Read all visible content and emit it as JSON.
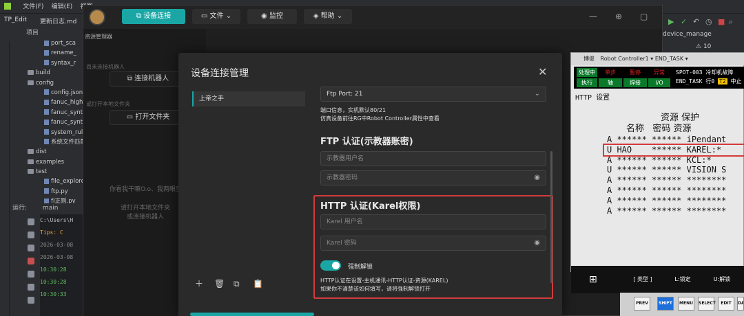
{
  "ide": {
    "menu": [
      "文件(F)",
      "编辑(E)",
      "视图"
    ],
    "project_name": "TP_Edit",
    "file_tab": "更新日志.md",
    "project_label": "项目",
    "tree": [
      {
        "type": "file",
        "label": "port_sca"
      },
      {
        "type": "file",
        "label": "rename_"
      },
      {
        "type": "file",
        "label": "syntax_r"
      },
      {
        "type": "folder",
        "label": "build"
      },
      {
        "type": "folder",
        "label": "config"
      },
      {
        "type": "file",
        "label": "config.json"
      },
      {
        "type": "file",
        "label": "fanuc_highli"
      },
      {
        "type": "file",
        "label": "fanuc_synta"
      },
      {
        "type": "file",
        "label": "fanuc_synta"
      },
      {
        "type": "file",
        "label": "system_rule"
      },
      {
        "type": "file",
        "label": "系统文件匹配"
      },
      {
        "type": "folder",
        "label": "dist"
      },
      {
        "type": "folder",
        "label": "examples"
      },
      {
        "type": "folder",
        "label": "test"
      },
      {
        "type": "file",
        "label": "file_explore"
      },
      {
        "type": "file",
        "label": "ftp.py"
      },
      {
        "type": "file",
        "label": "fI正则.py"
      }
    ],
    "run_label": "运行:",
    "run_tab": "main",
    "console": [
      "C:\\Users\\H",
      "Tips: C",
      "2026-03-08",
      "2026-03-08",
      "10:30:28",
      "10:30:28",
      "10:30:33"
    ],
    "right_dropdown": "device_manage",
    "right_count": "10"
  },
  "app": {
    "buttons": {
      "connect": "设备连接",
      "file": "文件",
      "monitor": "监控",
      "help": "帮助"
    },
    "left": {
      "title": "资源管理器",
      "not_connected": "尚未连接机器人",
      "connect_btn": "连接机器人",
      "no_folder": "或打开本地文件夹",
      "open_btn": "打开文件夹",
      "empty_msg": "你看我干嘛O.o、我两眼空空",
      "hint1": "请打开本地文件夹",
      "hint2": "或连接机器人"
    }
  },
  "modal": {
    "title": "设备连接管理",
    "device": "上帝之手",
    "ftp_port": "Ftp Port: 21",
    "port_note1": "端口信息，实机默认80/21",
    "port_note2": "仿真设备前往RG中Robot Controller属性中查看",
    "ftp_title": "FTP 认证(示教器账密)",
    "ftp_user_ph": "示教器用户名",
    "ftp_pass_ph": "示教器密码",
    "http_title": "HTTP 认证(Karel权限)",
    "karel_user_ph": "Karel 用户名",
    "karel_pass_ph": "Karel 密码",
    "force_unlock": "强制解锁",
    "http_note1": "HTTP认证在设置-主机通讯-HTTP认证-资源(KAREL)",
    "http_note2": "如果你不清楚该如何填写，请将强制解锁打开",
    "toggle_on": true
  },
  "pendant": {
    "app": "博俊",
    "controller": "Robot Controller1",
    "task": "END_TASK",
    "status_row1": [
      "处理中",
      "单步",
      "暂停",
      "异常"
    ],
    "status_row2": [
      "执行",
      "轴",
      "焊接",
      "I/O"
    ],
    "alarm": "SPOT-003 冷却机故障",
    "line2": "END_TASK 行0",
    "t2": "T2",
    "line2_tail": "中止",
    "screen_title": "HTTP 设置",
    "header1": "资源 保护",
    "header2": "名称   密码 资源",
    "rows": [
      "A ****** ****** iPendant",
      "U HAO    ****** KAREL:*",
      "A ****** ****** KCL:*",
      "U ****** ****** VISION S",
      "A ****** ****** ********",
      "A ****** ****** ********",
      "A ****** ****** ********",
      "A ****** ****** ********"
    ],
    "softkeys": [
      "[ 类型 ]",
      "L:锁定",
      "U:解锁"
    ],
    "keys": [
      "PREV",
      "SHIFT",
      "MENU",
      "SELECT",
      "EDIT",
      "DATA"
    ]
  },
  "colors": {
    "accent": "#1ba6a6",
    "highlight": "#d33b3b"
  }
}
